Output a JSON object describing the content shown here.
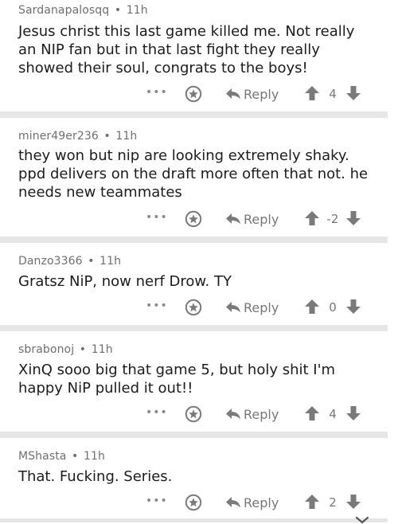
{
  "comments": [
    {
      "author": "Sardanapalosqq",
      "time": "11h",
      "text": "Jesus christ this last game killed me. Not really an NIP fan but in that last fight they really showed their soul, congrats to the boys!",
      "score": "4"
    },
    {
      "author": "miner49er236",
      "time": "11h",
      "text": "they won but nip are looking extremely shaky. ppd delivers on the draft more often that not. he needs new teammates",
      "score": "-2"
    },
    {
      "author": "Danzo3366",
      "time": "11h",
      "text": "Gratsz NiP, now nerf Drow. TY",
      "score": "0"
    },
    {
      "author": "sbrabonoj",
      "time": "11h",
      "text": "XinQ sooo big that game 5, but holy shit I'm happy NiP pulled it out!!",
      "score": "4"
    },
    {
      "author": "MShasta",
      "time": "11h",
      "text": "That. Fucking. Series.",
      "score": "2"
    }
  ],
  "labels": {
    "reply": "Reply",
    "more": "•••",
    "separator": "•"
  },
  "icons": {
    "more": "more-options-icon",
    "save": "save-icon",
    "reply": "reply-arrow-icon",
    "upvote": "upvote-arrow-icon",
    "downvote": "downvote-arrow-icon"
  },
  "colors": {
    "meta_text": "#6f6f6f",
    "body_text": "#1c1c1c",
    "action_gray": "#777777",
    "divider": "#e6e6e6"
  }
}
